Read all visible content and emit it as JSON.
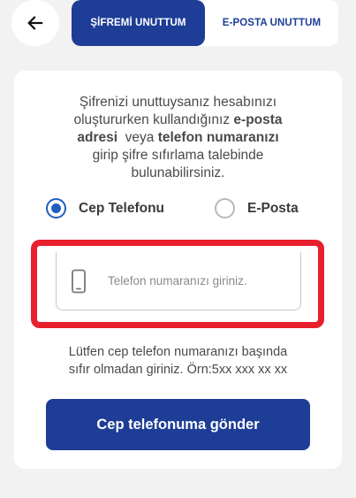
{
  "header": {
    "back_icon": "arrow-left-icon",
    "tabs": [
      {
        "label": "ŞİFREMİ UNUTTUM",
        "active": true
      },
      {
        "label": "E-POSTA UNUTTUM",
        "active": false
      }
    ]
  },
  "card": {
    "description": {
      "line1": "Şifrenizi unuttuysanız hesabınızı",
      "line2_plain": "oluştururken kullandığınız ",
      "line2_bold": "e-posta",
      "line3_bold": "adresi",
      "line3_plain": "  veya ",
      "line3_bold2": "telefon numaranızı",
      "line4": "girip şifre sıfırlama talebinde",
      "line5": "bulunabilirsiniz."
    },
    "options": [
      {
        "label": "Cep Telefonu",
        "selected": true
      },
      {
        "label": "E-Posta",
        "selected": false
      }
    ],
    "phone_input": {
      "value": "",
      "placeholder": "Telefon numaranızı giriniz.",
      "icon": "mobile-phone-icon"
    },
    "hint_line1": "Lütfen cep telefon numaranızı başında",
    "hint_line2": "sıfır olmadan giriniz. Örn:5xx xxx xx xx",
    "submit_label": "Cep telefonuma gönder"
  },
  "colors": {
    "primary": "#1e3d96",
    "radio_selected": "#1e5fbf",
    "highlight": "#e8202e",
    "background": "#f2f2f2"
  }
}
